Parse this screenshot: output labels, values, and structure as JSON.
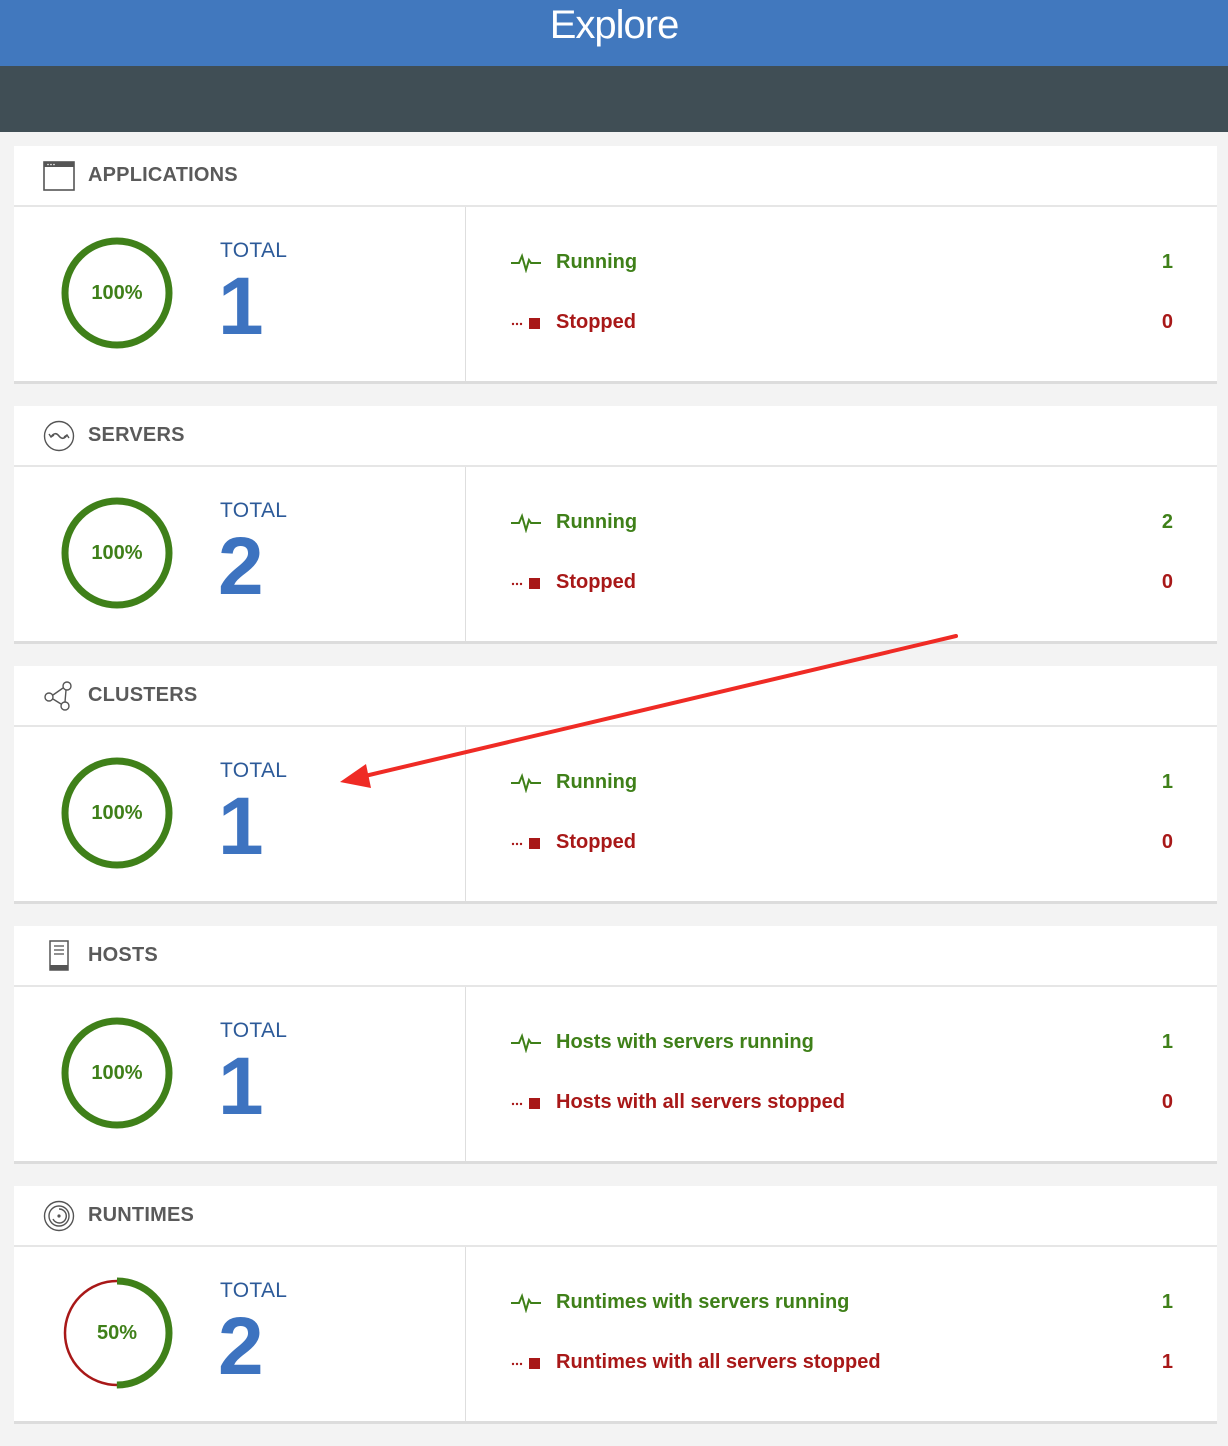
{
  "header": {
    "title": "Explore"
  },
  "colors": {
    "brand": "#4178be",
    "subbar": "#404e55",
    "running": "#3f8019",
    "stopped": "#a81818",
    "total": "#3d73c0",
    "annotation_arrow": "#ef2b25"
  },
  "sections": [
    {
      "title": "APPLICATIONS",
      "icon": "window-icon",
      "percent_label": "100%",
      "percent": 100,
      "total_label": "TOTAL",
      "total": "1",
      "running_label": "Running",
      "running_count": "1",
      "stopped_label": "Stopped",
      "stopped_count": "0"
    },
    {
      "title": "SERVERS",
      "icon": "server-sync-icon",
      "percent_label": "100%",
      "percent": 100,
      "total_label": "TOTAL",
      "total": "2",
      "running_label": "Running",
      "running_count": "2",
      "stopped_label": "Stopped",
      "stopped_count": "0"
    },
    {
      "title": "CLUSTERS",
      "icon": "cluster-nodes-icon",
      "percent_label": "100%",
      "percent": 100,
      "total_label": "TOTAL",
      "total": "1",
      "running_label": "Running",
      "running_count": "1",
      "stopped_label": "Stopped",
      "stopped_count": "0"
    },
    {
      "title": "HOSTS",
      "icon": "host-tower-icon",
      "percent_label": "100%",
      "percent": 100,
      "total_label": "TOTAL",
      "total": "1",
      "running_label": "Hosts with servers running",
      "running_count": "1",
      "stopped_label": "Hosts with all servers stopped",
      "stopped_count": "0"
    },
    {
      "title": "RUNTIMES",
      "icon": "runtime-icon",
      "percent_label": "50%",
      "percent": 50,
      "total_label": "TOTAL",
      "total": "2",
      "running_label": "Runtimes with servers running",
      "running_count": "1",
      "stopped_label": "Runtimes with all servers stopped",
      "stopped_count": "1"
    }
  ]
}
